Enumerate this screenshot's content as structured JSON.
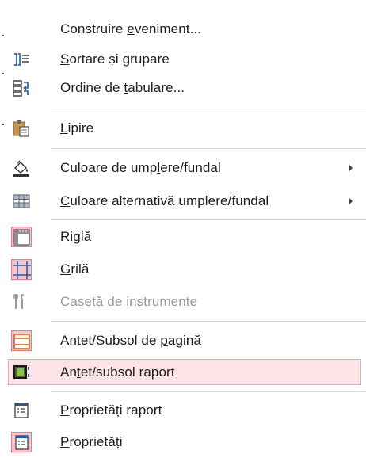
{
  "menu": {
    "items": [
      {
        "id": "construire",
        "pre": "Construire ",
        "key": "e",
        "post": "veniment...",
        "icon": "blank",
        "checked": false,
        "disabled": false,
        "submenu": false
      },
      {
        "id": "sortare",
        "pre": "",
        "key": "S",
        "post": "ortare și grupare",
        "icon": "sort-group-icon",
        "checked": false,
        "disabled": false,
        "submenu": false
      },
      {
        "id": "ordine",
        "pre": "Ordine de ",
        "key": "t",
        "post": "abulare...",
        "icon": "tab-order-icon",
        "checked": false,
        "disabled": false,
        "submenu": false
      },
      {
        "id": "lipire",
        "pre": "",
        "key": "L",
        "post": "ipire",
        "icon": "paste-icon",
        "checked": false,
        "disabled": false,
        "submenu": false
      },
      {
        "id": "culoare",
        "pre": "Culoare de ump",
        "key": "l",
        "post": "ere/fundal",
        "icon": "fill-color-icon",
        "checked": false,
        "disabled": false,
        "submenu": true
      },
      {
        "id": "culoare-alt",
        "pre": "",
        "key": "C",
        "post": "uloare alternativă umplere/fundal",
        "icon": "alternate-fill-icon",
        "checked": false,
        "disabled": false,
        "submenu": true
      },
      {
        "id": "rigla",
        "pre": "",
        "key": "R",
        "post": "iglă",
        "icon": "ruler-icon",
        "checked": true,
        "disabled": false,
        "submenu": false
      },
      {
        "id": "grila",
        "pre": "",
        "key": "G",
        "post": "rilă",
        "icon": "grid-icon",
        "checked": true,
        "disabled": false,
        "submenu": false
      },
      {
        "id": "caseta",
        "pre": "Casetă ",
        "key": "d",
        "post": "e instrumente",
        "icon": "toolbox-icon",
        "checked": false,
        "disabled": true,
        "submenu": false
      },
      {
        "id": "antet-pagina",
        "pre": "Antet/Subsol de ",
        "key": "p",
        "post": "agină",
        "icon": "page-header-footer-icon",
        "checked": true,
        "disabled": false,
        "submenu": false
      },
      {
        "id": "antet-raport",
        "pre": "An",
        "key": "t",
        "post": "et/subsol raport",
        "icon": "report-header-footer-icon",
        "checked": false,
        "disabled": false,
        "submenu": false,
        "highlighted": true
      },
      {
        "id": "proprietati-raport",
        "pre": "",
        "key": "P",
        "post": "roprietăți raport",
        "icon": "report-properties-icon",
        "checked": false,
        "disabled": false,
        "submenu": false
      },
      {
        "id": "proprietati",
        "pre": "",
        "key": "P",
        "post": "roprietăți",
        "icon": "properties-icon",
        "checked": true,
        "disabled": false,
        "submenu": false
      }
    ]
  }
}
